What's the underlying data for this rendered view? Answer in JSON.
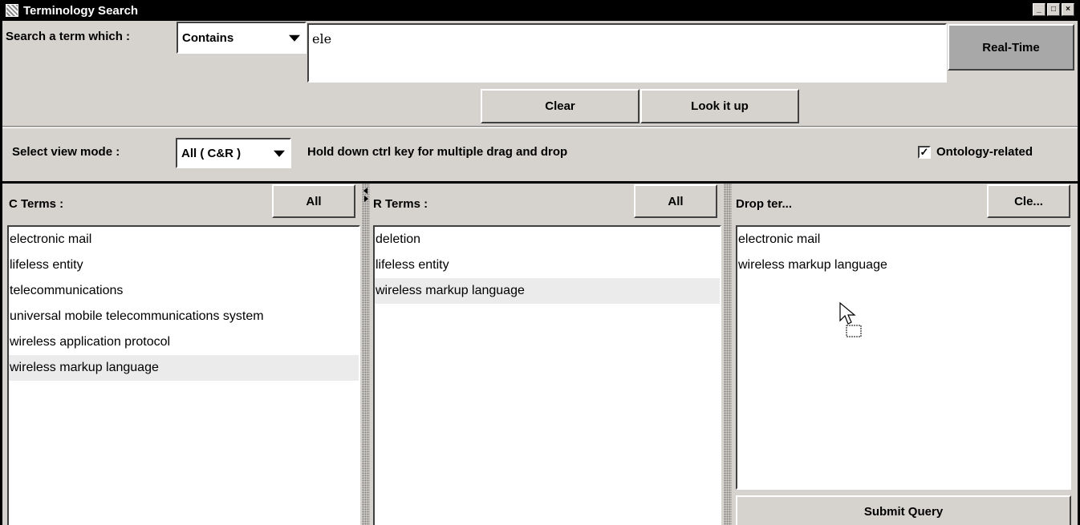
{
  "window": {
    "title": "Terminology Search"
  },
  "search": {
    "label": "Search a term which :",
    "mode": "Contains",
    "value": "ele",
    "realtime_label": "Real-Time",
    "clear_label": "Clear",
    "lookup_label": "Look it up"
  },
  "view": {
    "label": "Select view mode :",
    "mode": "All ( C&R )",
    "hint": "Hold down ctrl key for multiple drag and drop",
    "ontology_label": "Ontology-related",
    "ontology_checked": true
  },
  "c_terms": {
    "label": "C Terms :",
    "all_label": "All",
    "items": [
      "electronic mail",
      "lifeless entity",
      "telecommunications",
      "universal mobile telecommunications system",
      "wireless application protocol",
      "wireless markup language"
    ],
    "selected_index": 5
  },
  "r_terms": {
    "label": "R Terms :",
    "all_label": "All",
    "items": [
      "deletion",
      "lifeless entity",
      "wireless markup language"
    ],
    "selected_index": 2
  },
  "drop": {
    "label": "Drop ter...",
    "clear_label": "Cle...",
    "items": [
      "electronic mail",
      "wireless markup language"
    ],
    "submit_label": "Submit Query"
  }
}
